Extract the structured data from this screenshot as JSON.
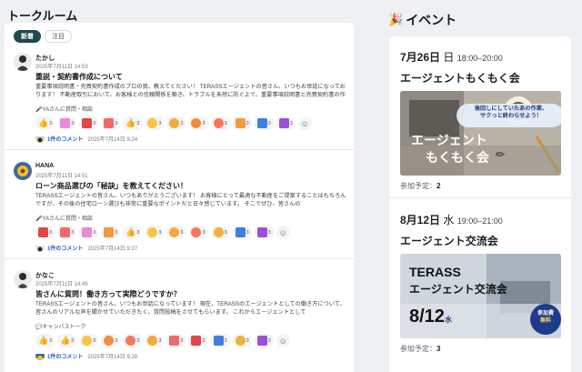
{
  "left": {
    "title": "トークルーム",
    "tabs": [
      {
        "label": "新着",
        "active": true
      },
      {
        "label": "注目",
        "active": false
      }
    ],
    "posts": [
      {
        "author": "たかし",
        "date": "2025年7月11日 14:53",
        "title": "重説・契約書作成について",
        "body": "重要事項説明書・売買契約書作成のプロの我、教えてください！ TERASSエージェントの皆さん、いつもお世話になっております！ 不動産取引において、お客様との信頼関係を築き、トラブルを未然に防ぐ上で、重要事項説明書と売買契約書の作成は非常に重要です",
        "tag": "🎤YAさんに質問・相談",
        "reactions": [
          "3",
          "3",
          "3",
          "3",
          "3",
          "3",
          "3",
          "3",
          "3",
          "3",
          "3",
          "3",
          "3"
        ],
        "comment_link": "1件のコメント",
        "comment_date": "2025年7月14日 9:24"
      },
      {
        "author": "HANA",
        "date": "2025年7月11日 14:51",
        "title": "ローン商品選びの「秘訣」を教えてください！",
        "body": "TERASSエージェントの皆さん、いつもありがとうございます！ お客様にとって最適な不動産をご提案することはもちろんですが、その後の住宅ローン選びも非常に重要なポイントだと日々感じています。 そこでぜひ、皆さんの",
        "tag": "🎤YAさんに質問・相談",
        "reactions": [
          "3",
          "3",
          "3",
          "3",
          "3",
          "3",
          "3",
          "3",
          "3",
          "3",
          "3"
        ],
        "comment_link": "1件のコメント",
        "comment_date": "2025年7月14日 9:27"
      },
      {
        "author": "かなこ",
        "date": "2025年7月11日 14:49",
        "title": "皆さんに質問！働き方って実際どうですか？",
        "body": "TERASSエージェントの皆さん、いつもお世話になっています！ 現在、TERASSのエージェントとしての働き方について、皆さんのリアルな声を聞かせていただきたく、質問投稿をさせてもらいます。 これからエージェントとして",
        "tag": "💬キャンバストーク",
        "reactions": [
          "3",
          "3",
          "3",
          "3",
          "3",
          "3",
          "3",
          "3",
          "3",
          "3",
          "3"
        ],
        "comment_link": "1件のコメント",
        "comment_date": "2025年7月14日 9:28"
      }
    ]
  },
  "right": {
    "title": "イベント",
    "events": [
      {
        "date": "7月26日",
        "weekday": "日",
        "time": "18:00–20:00",
        "name": "エージェントもくもく会",
        "banner_sub": "後回しにしていたあの作業、\nサクっと終わらせよう！",
        "banner_main_1": "エージェント",
        "banner_main_2": "もくもく会",
        "count_label": "参加予定：",
        "count": "2"
      },
      {
        "date": "8月12日",
        "weekday": "水",
        "time": "19:00–21:00",
        "name": "エージェント交流会",
        "banner_brand": "TERASS",
        "banner_title": "エージェント交流会",
        "banner_date": "8/12",
        "banner_wd": "水",
        "badge_1": "参加費",
        "badge_2": "無料",
        "count_label": "参加予定：",
        "count": "3"
      }
    ]
  },
  "colors": {
    "tab_active": "#1f4a4d",
    "link": "#1f5bd8",
    "banner_blue": "#1e3a8a"
  }
}
